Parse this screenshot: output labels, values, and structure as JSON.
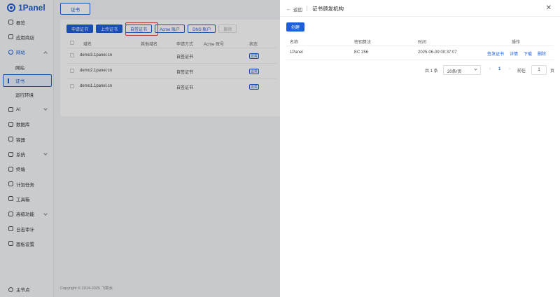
{
  "app": {
    "logo_text": "1Panel"
  },
  "sidebar": {
    "items": [
      {
        "label": "概览",
        "icon": "home-icon"
      },
      {
        "label": "应用商店",
        "icon": "store-icon"
      },
      {
        "label": "网站",
        "icon": "globe-icon",
        "expanded": true
      },
      {
        "label": "网站",
        "sub": true
      },
      {
        "label": "证书",
        "sub": true,
        "selected": true
      },
      {
        "label": "运行环境",
        "sub": true
      },
      {
        "label": "AI",
        "icon": "ai-icon",
        "chevron": true
      },
      {
        "label": "数据库",
        "icon": "database-icon"
      },
      {
        "label": "容器",
        "icon": "container-icon"
      },
      {
        "label": "系统",
        "icon": "system-icon",
        "chevron": true
      },
      {
        "label": "终端",
        "icon": "terminal-icon"
      },
      {
        "label": "计划任务",
        "icon": "cron-icon"
      },
      {
        "label": "工具箱",
        "icon": "toolbox-icon"
      },
      {
        "label": "高级功能",
        "icon": "advanced-icon",
        "chevron": true
      },
      {
        "label": "日志审计",
        "icon": "log-icon"
      },
      {
        "label": "面板设置",
        "icon": "settings-icon"
      }
    ],
    "footer": {
      "label": "主节点",
      "icon": "user-icon"
    }
  },
  "main": {
    "tab_label": "证书",
    "buttons": {
      "apply": "申请证书",
      "upload": "上传证书",
      "self_signed": "自签证书",
      "acme": "Acme 账户",
      "dns": "DNS 账户",
      "delete": "删除"
    },
    "table": {
      "headers": [
        "域名",
        "其他域名",
        "申请方式",
        "Acme 账号",
        "状态"
      ],
      "rows": [
        {
          "domain": "demo3.1panel.cn",
          "method": "自签证书",
          "status": "正常"
        },
        {
          "domain": "demo2.1panel.cn",
          "method": "自签证书",
          "status": "正常"
        },
        {
          "domain": "demo1.1panel.cn",
          "method": "自签证书",
          "status": "正常"
        }
      ]
    },
    "copyright": "Copyright © 2014-2025 飞致云"
  },
  "drawer": {
    "back_label": "返回",
    "title": "证书颁发机构",
    "create_label": "创建",
    "table": {
      "headers": [
        "名称",
        "密钥算法",
        "时间",
        "操作"
      ],
      "rows": [
        {
          "name": "1Panel",
          "algo": "EC 256",
          "time": "2025-06-09 00:37:07",
          "actions": {
            "issue": "签发证书",
            "detail": "详情",
            "download": "下载",
            "delete": "删除"
          }
        }
      ]
    },
    "pager": {
      "total": "共 1 条",
      "page_size": "20条/页",
      "current": "1",
      "goto_label": "前往",
      "goto_value": "1",
      "page_suffix": "页"
    }
  },
  "colors": {
    "accent": "#1f5fd6",
    "highlight": "#e0413a"
  }
}
